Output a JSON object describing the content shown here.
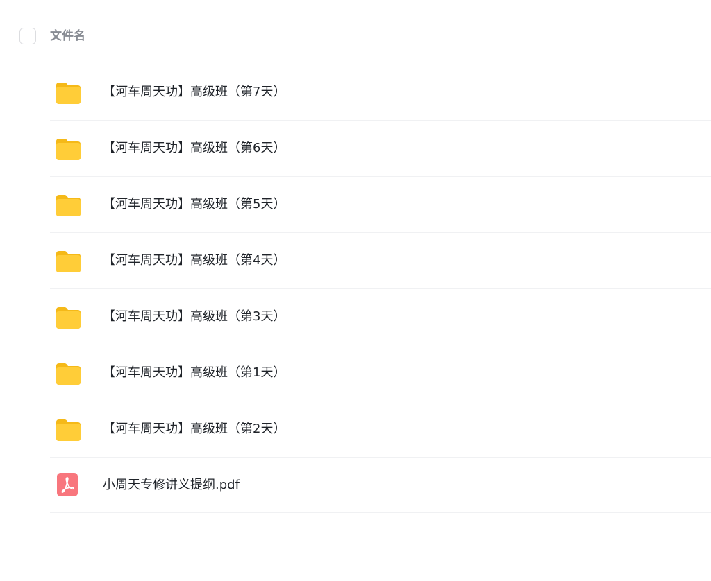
{
  "header": {
    "column_title": "文件名"
  },
  "files": [
    {
      "name": "【河车周天功】高级班（第7天）",
      "type": "folder",
      "icon": "folder-icon"
    },
    {
      "name": "【河车周天功】高级班（第6天）",
      "type": "folder",
      "icon": "folder-icon"
    },
    {
      "name": "【河车周天功】高级班（第5天）",
      "type": "folder",
      "icon": "folder-icon"
    },
    {
      "name": "【河车周天功】高级班（第4天）",
      "type": "folder",
      "icon": "folder-icon"
    },
    {
      "name": "【河车周天功】高级班（第3天）",
      "type": "folder",
      "icon": "folder-icon"
    },
    {
      "name": "【河车周天功】高级班（第1天）",
      "type": "folder",
      "icon": "folder-icon"
    },
    {
      "name": "【河车周天功】高级班（第2天）",
      "type": "folder",
      "icon": "folder-icon"
    },
    {
      "name": "小周天专修讲义提纲.pdf",
      "type": "pdf",
      "icon": "pdf-icon"
    }
  ],
  "colors": {
    "folder": "#ffc933",
    "folder_tab": "#f5b918",
    "pdf": "#f8767d",
    "divider": "#f0f1f3",
    "header_text": "#878b93"
  }
}
